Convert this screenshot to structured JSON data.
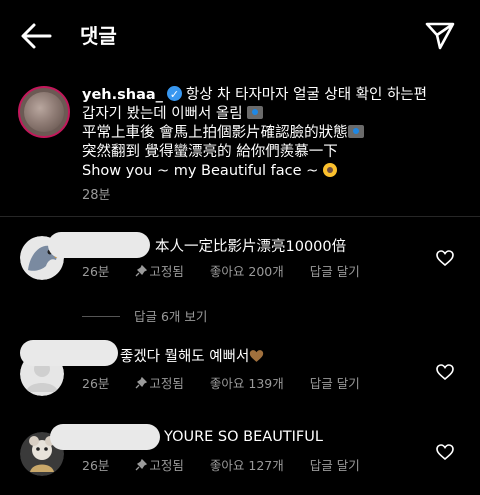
{
  "header": {
    "title": "댓글",
    "back_icon": "back-arrow-icon",
    "send_icon": "send-icon"
  },
  "caption": {
    "username": "yeh.shaa_",
    "line1": "항상 차 타자마자 얼굴 상태 확인 하는편",
    "line2": "갑자기 봤는데 이뻐서 올림",
    "line3": "平常上車後 會馬上拍個影片確認臉的狀態",
    "line4": "突然翻到 覺得蠻漂亮的 給你們羨慕一下",
    "line5": "Show you ~ my Beautiful face ~",
    "time": "28분"
  },
  "comments": [
    {
      "text": "本人一定比影片漂亮10000倍",
      "time": "26분",
      "pinned": "고정됨",
      "likes": "좋아요 200개",
      "reply": "답글 달기",
      "view_replies": "답글 6개 보기"
    },
    {
      "text": "좋겠다 뭘해도 예뻐서",
      "time": "26분",
      "pinned": "고정됨",
      "likes": "좋아요 139개",
      "reply": "답글 달기"
    },
    {
      "text": "YOURE SO BEAUTIFUL",
      "time": "26분",
      "pinned": "고정됨",
      "likes": "좋아요 127개",
      "reply": "답글 달기"
    }
  ]
}
